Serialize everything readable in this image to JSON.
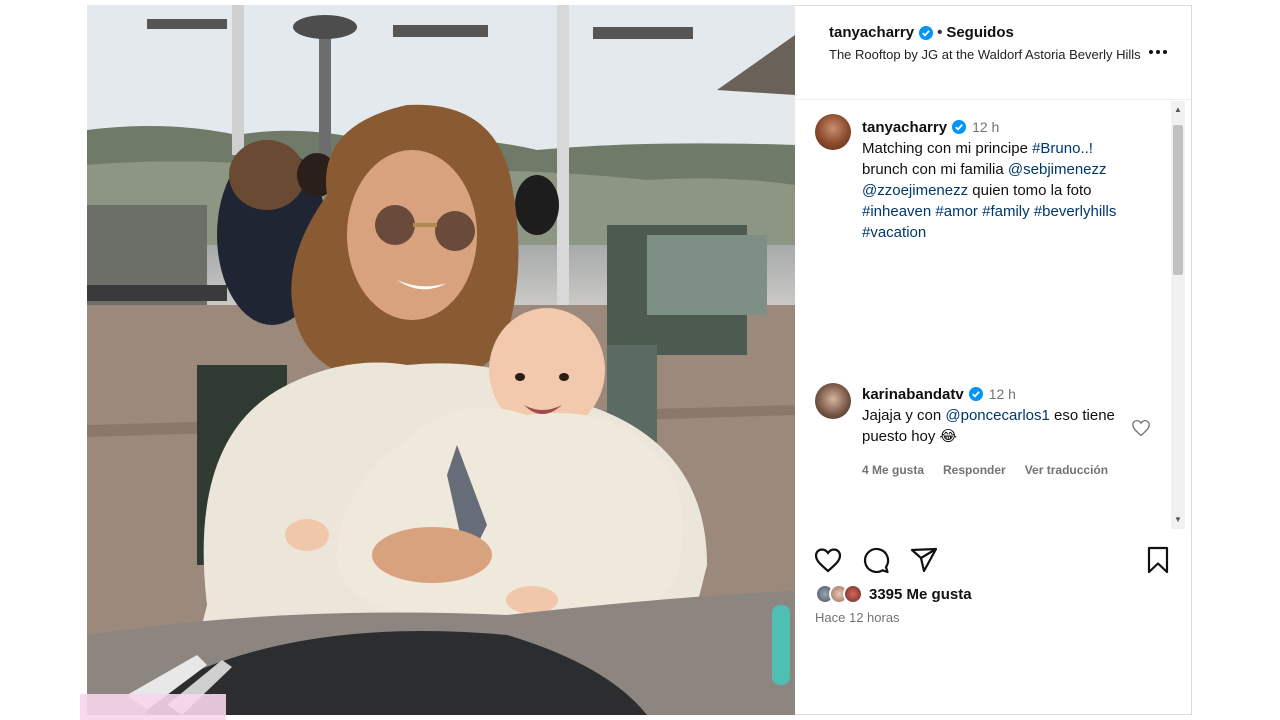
{
  "header": {
    "username": "tanyacharry",
    "follow_status": "Seguidos",
    "separator": "•",
    "location": "The Rooftop by JG at the Waldorf Astoria Beverly Hills"
  },
  "caption": {
    "username": "tanyacharry",
    "time": "12 h",
    "line1_prefix": "Matching con mi principe ",
    "line1_tag": "#Bruno..!",
    "line2_prefix": "brunch con mi familia ",
    "line2_tag": "@sebjimenezz",
    "line3_tag": "@zzoejimenezz",
    "line3_suffix": " quien tomo la foto",
    "line4_tags": [
      "#inheaven",
      "#amor",
      "#family",
      "#beverlyhills"
    ],
    "line5_tag": "#vacation"
  },
  "comment": {
    "username": "karinabandatv",
    "time": "12 h",
    "text_prefix": "Jajaja y con ",
    "mention": "@poncecarlos1",
    "text_suffix": " eso tiene puesto hoy 😂",
    "likes": "4 Me gusta",
    "reply": "Responder",
    "translate": "Ver traducción"
  },
  "post": {
    "likes_label": "3395 Me gusta",
    "posted": "Hace 12 horas"
  },
  "icons": {
    "verified": "verified-badge-icon",
    "more": "more-options-icon",
    "like": "heart-icon",
    "comment": "comment-icon",
    "share": "send-icon",
    "save": "bookmark-icon"
  },
  "colors": {
    "verified": "#0095f6",
    "link": "#00376b",
    "muted": "#737373"
  }
}
